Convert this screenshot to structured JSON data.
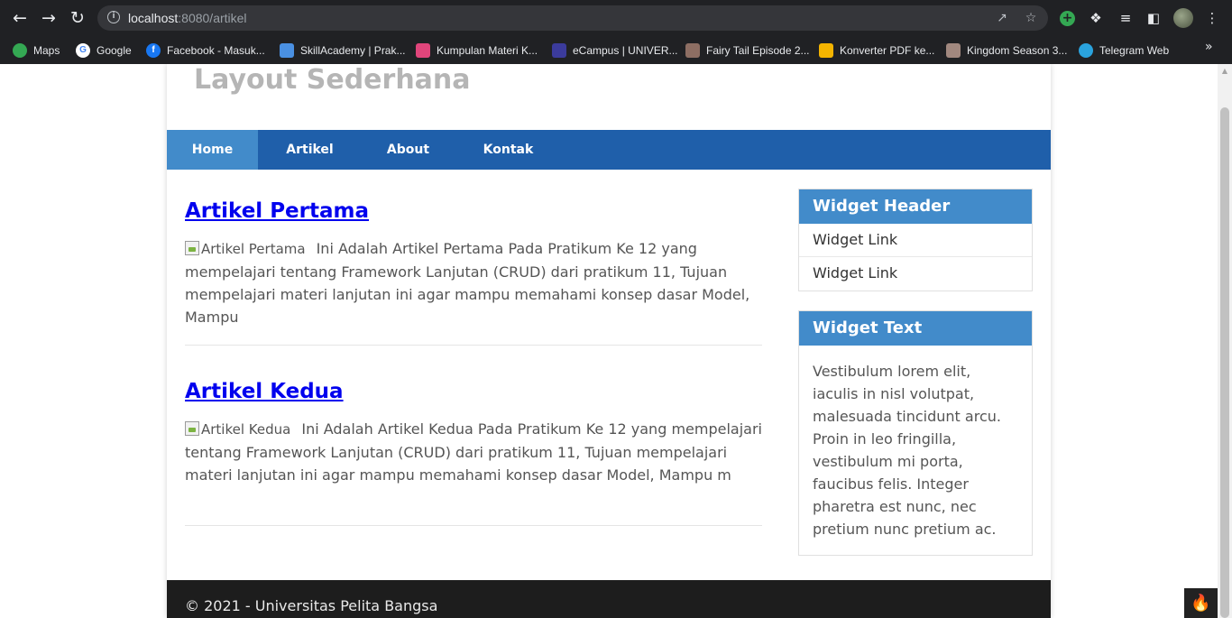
{
  "browser": {
    "url_host": "localhost",
    "url_rest": ":8080/artikel",
    "bookmarks": [
      {
        "label": "Maps",
        "icon": "maps-pin-icon",
        "color": "#34a853"
      },
      {
        "label": "Google",
        "icon": "google-g-icon",
        "color": "#ffffff"
      },
      {
        "label": "Facebook - Masuk...",
        "icon": "facebook-icon",
        "color": "#1877f2"
      },
      {
        "label": "SkillAcademy | Prak...",
        "icon": "skillacademy-icon",
        "color": "#4a90e2"
      },
      {
        "label": "Kumpulan Materi K...",
        "icon": "leaf-icon",
        "color": "#e0457b"
      },
      {
        "label": "eCampus | UNIVER...",
        "icon": "ecampus-icon",
        "color": "#3b3b9c"
      },
      {
        "label": "Fairy Tail Episode 2...",
        "icon": "anime-icon",
        "color": "#8d6e63"
      },
      {
        "label": "Konverter PDF ke...",
        "icon": "pdf-converter-icon",
        "color": "#f4b400"
      },
      {
        "label": "Kingdom Season 3...",
        "icon": "kingdom-icon",
        "color": "#a1887f"
      },
      {
        "label": "Telegram Web",
        "icon": "telegram-icon",
        "color": "#2aa3de"
      }
    ]
  },
  "site": {
    "title": "Layout Sederhana"
  },
  "nav": {
    "items": [
      "Home",
      "Artikel",
      "About",
      "Kontak"
    ],
    "active": "Home"
  },
  "articles": [
    {
      "title": "Artikel Pertama",
      "image_alt": "Artikel Pertama",
      "excerpt": "Ini Adalah Artikel Pertama Pada Pratikum Ke 12 yang mempelajari tentang Framework Lanjutan (CRUD) dari pratikum 11, Tujuan mempelajari materi lanjutan ini agar mampu memahami konsep dasar Model, Mampu"
    },
    {
      "title": "Artikel Kedua",
      "image_alt": "Artikel Kedua",
      "excerpt": "Ini Adalah Artikel Kedua Pada Pratikum Ke 12 yang mempelajari tentang Framework Lanjutan (CRUD) dari pratikum 11, Tujuan mempelajari materi lanjutan ini agar mampu memahami konsep dasar Model, Mampu m"
    }
  ],
  "sidebar": {
    "widget1": {
      "header": "Widget Header",
      "links": [
        "Widget Link",
        "Widget Link"
      ]
    },
    "widget2": {
      "header": "Widget Text",
      "text": "Vestibulum lorem elit, iaculis in nisl volutpat, malesuada tincidunt arcu. Proin in leo fringilla, vestibulum mi porta, faucibus felis. Integer pharetra est nunc, nec pretium nunc pretium ac."
    }
  },
  "footer": {
    "text": "© 2021 - Universitas Pelita Bangsa"
  },
  "colors": {
    "nav_bar": "#1f5faa",
    "nav_active": "#428bca",
    "widget_header": "#428bca",
    "footer": "#1d1d1d",
    "link": "#0000ee"
  }
}
